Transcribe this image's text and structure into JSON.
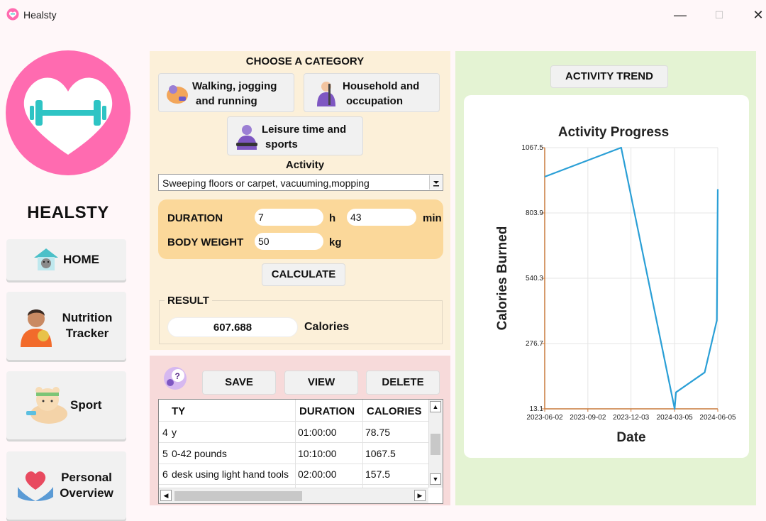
{
  "window": {
    "title": "Healsty",
    "minimize": "—",
    "maximize": "☐",
    "close": "✕"
  },
  "sidebar": {
    "brand": "HEALSTY",
    "home": "HOME",
    "nutrition": [
      "Nutrition",
      "Tracker"
    ],
    "sport": "Sport",
    "personal": [
      "Personal",
      "Overview"
    ]
  },
  "category": {
    "title": "CHOOSE A CATEGORY",
    "walking": [
      "Walking, jogging",
      "and running"
    ],
    "household": [
      "Household and",
      "occupation"
    ],
    "leisure": [
      "Leisure time and",
      "sports"
    ]
  },
  "activity": {
    "label": "Activity",
    "selected": "Sweeping floors or carpet, vacuuming,mopping"
  },
  "inputs": {
    "duration_label": "DURATION",
    "hours": "7",
    "hours_unit": "h",
    "minutes": "43",
    "minutes_unit": "min",
    "weight_label": "BODY WEIGHT",
    "weight": "50",
    "weight_unit": "kg"
  },
  "calculate_label": "CALCULATE",
  "result": {
    "label": "RESULT",
    "value": "607.688",
    "unit": "Calories"
  },
  "actions": {
    "save": "SAVE",
    "view": "VIEW",
    "delete": "DELETE"
  },
  "table": {
    "headers": {
      "activity": "TY",
      "duration": "DURATION",
      "calories": "CALORIES"
    },
    "rows": [
      {
        "index": "4",
        "activity": "y",
        "duration": "01:00:00",
        "calories": "78.75"
      },
      {
        "index": "5",
        "activity": "0-42 pounds",
        "duration": "10:10:00",
        "calories": "1067.5"
      },
      {
        "index": "6",
        "activity": "desk using light hand tools",
        "duration": "02:00:00",
        "calories": "157.5"
      }
    ]
  },
  "trend_button": "ACTIVITY TREND",
  "colors": {
    "line": "#2a9fd6",
    "axis": "#c97a3c",
    "brand_pink": "#ff6bb0",
    "dumbbell": "#2ec4c4"
  },
  "chart_data": {
    "type": "line",
    "title": "Activity Progress",
    "xlabel": "Date",
    "ylabel": "Calories Burned",
    "ylim": [
      13.1,
      1067.5
    ],
    "y_ticks": [
      "13.1",
      "276.7",
      "540.3",
      "803.9",
      "1067.5"
    ],
    "x_ticks": [
      "2023-06-02",
      "2023-09-02",
      "2023-12-03",
      "2024-03-05",
      "2024-06-05"
    ],
    "xlim": [
      "2023-06-02",
      "2024-06-05"
    ],
    "grid": true,
    "series": [
      {
        "x": [
          "2023-06-02",
          "2023-11-12",
          "2024-03-05",
          "2024-03-08",
          "2024-05-08",
          "2024-06-03",
          "2024-06-05"
        ],
        "y": [
          950,
          1067.5,
          13.1,
          80,
          160,
          370,
          900
        ]
      }
    ]
  }
}
